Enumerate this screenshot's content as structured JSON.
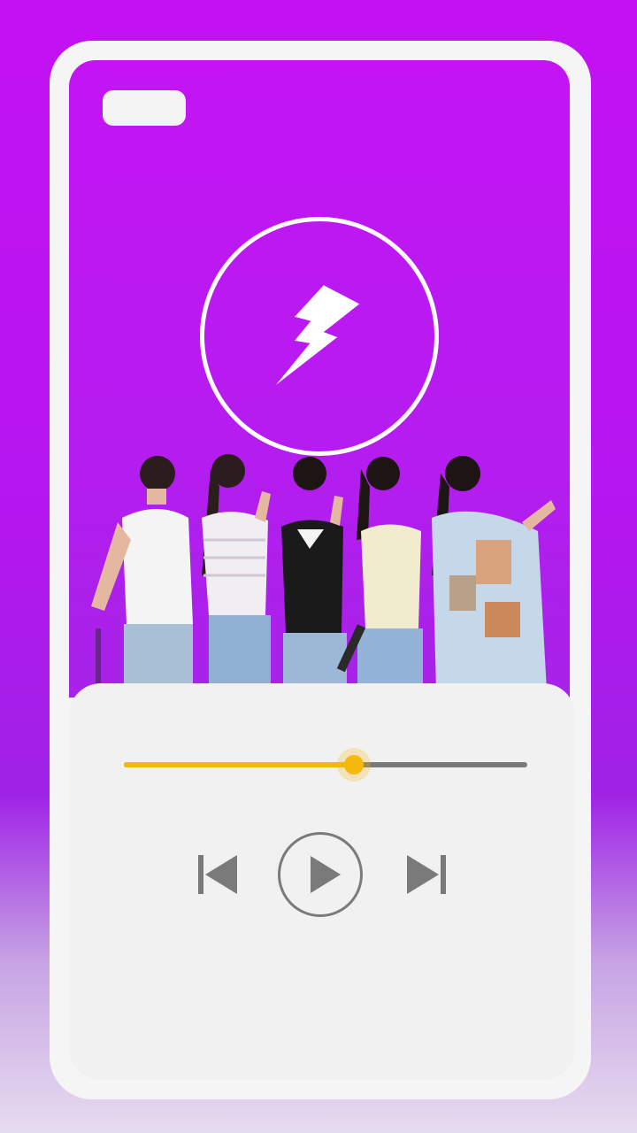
{
  "app": {
    "logo_icon": "lightning-bolt-icon",
    "accent_color": "#f5b90b",
    "background_color": "#c414f4"
  },
  "album_art": {
    "subject": "group-photo"
  },
  "player": {
    "progress": 0.57,
    "controls": {
      "previous_icon": "skip-previous-icon",
      "play_icon": "play-icon",
      "next_icon": "skip-next-icon"
    }
  }
}
